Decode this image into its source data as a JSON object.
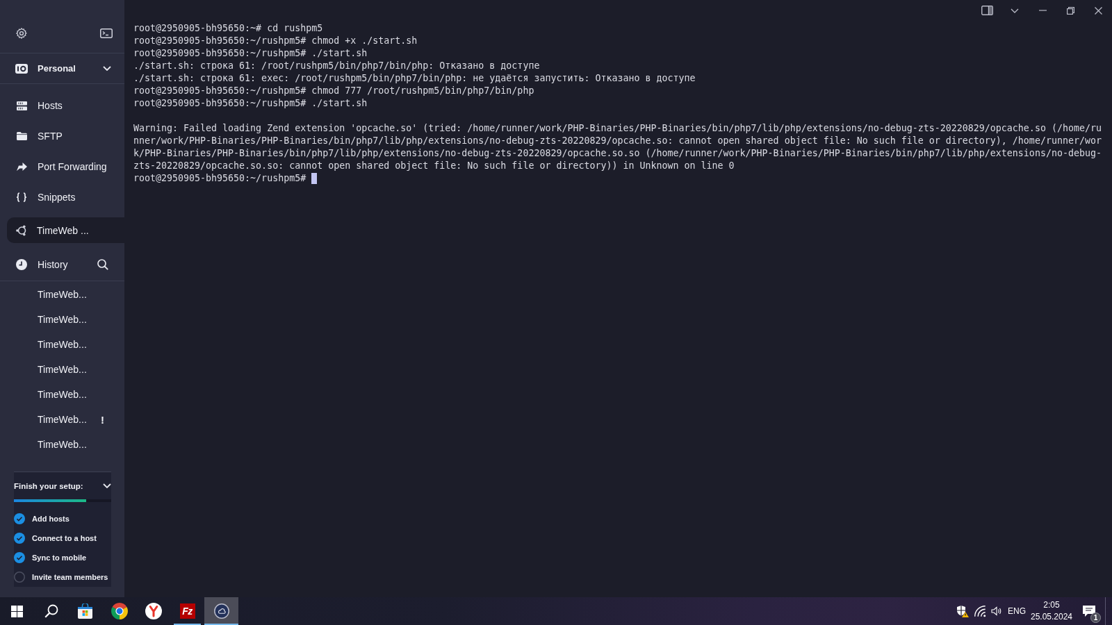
{
  "sidebar": {
    "vault": {
      "label": "Personal"
    },
    "nav": [
      {
        "label": "Hosts"
      },
      {
        "label": "SFTP"
      },
      {
        "label": "Port Forwarding"
      },
      {
        "label": "Snippets"
      }
    ],
    "sessions": [
      {
        "label": "TimeWeb ...",
        "selected": true
      }
    ],
    "history": {
      "label": "History",
      "items": [
        {
          "label": "TimeWeb..."
        },
        {
          "label": "TimeWeb..."
        },
        {
          "label": "TimeWeb..."
        },
        {
          "label": "TimeWeb..."
        },
        {
          "label": "TimeWeb..."
        },
        {
          "label": "TimeWeb...",
          "alert": "!"
        },
        {
          "label": "TimeWeb..."
        }
      ]
    },
    "setup": {
      "title": "Finish your setup:",
      "level": 0.74,
      "tasks": [
        {
          "label": "Add hosts",
          "checked": true
        },
        {
          "label": "Connect to a host",
          "checked": true
        },
        {
          "label": "Sync to mobile",
          "checked": true
        },
        {
          "label": "Invite team members",
          "checked": false
        }
      ]
    }
  },
  "terminal": {
    "blocks": [
      {
        "lines": [
          "root@2950905-bh95650:~# cd rushpm5",
          "root@2950905-bh95650:~/rushpm5# chmod +x ./start.sh",
          "root@2950905-bh95650:~/rushpm5# ./start.sh",
          "./start.sh: строка 61: /root/rushpm5/bin/php7/bin/php: Отказано в доступе",
          "./start.sh: строка 61: exec: /root/rushpm5/bin/php7/bin/php: не удаётся запустить: Отказано в доступе",
          "root@2950905-bh95650:~/rushpm5# chmod 777 /root/rushpm5/bin/php7/bin/php",
          "root@2950905-bh95650:~/rushpm5# ./start.sh"
        ]
      },
      {
        "lines": [
          "Warning: Failed loading Zend extension 'opcache.so' (tried: /home/runner/work/PHP-Binaries/PHP-Binaries/bin/php7/lib/php/extensions/no-debug-zts-20220829/opcache.so (/home/ru",
          "nner/work/PHP-Binaries/PHP-Binaries/bin/php7/lib/php/extensions/no-debug-zts-20220829/opcache.so: cannot open shared object file: No such file or directory), /home/runner/wor",
          "k/PHP-Binaries/PHP-Binaries/bin/php7/lib/php/extensions/no-debug-zts-20220829/opcache.so.so (/home/runner/work/PHP-Binaries/PHP-Binaries/bin/php7/lib/php/extensions/no-debug-",
          "zts-20220829/opcache.so.so: cannot open shared object file: No such file or directory)) in Unknown on line 0",
          "root@2950905-bh95650:~/rushpm5#"
        ]
      }
    ],
    "cursor": true
  },
  "taskbar": {
    "apps": [
      {
        "kind": "start",
        "selected": false,
        "running": false
      },
      {
        "kind": "search",
        "selected": false,
        "running": false
      },
      {
        "kind": "store",
        "selected": false,
        "running": false
      },
      {
        "kind": "wheel",
        "selected": false,
        "running": false
      },
      {
        "kind": "fork",
        "selected": false,
        "running": false
      },
      {
        "kind": "tile",
        "logo": "Fz",
        "selected": false,
        "running": true
      },
      {
        "kind": "ring",
        "selected": true,
        "running": true
      }
    ],
    "tray": {
      "language": "ENG",
      "time": "2:05",
      "date": "25.05.2024",
      "notifications": "1"
    }
  }
}
